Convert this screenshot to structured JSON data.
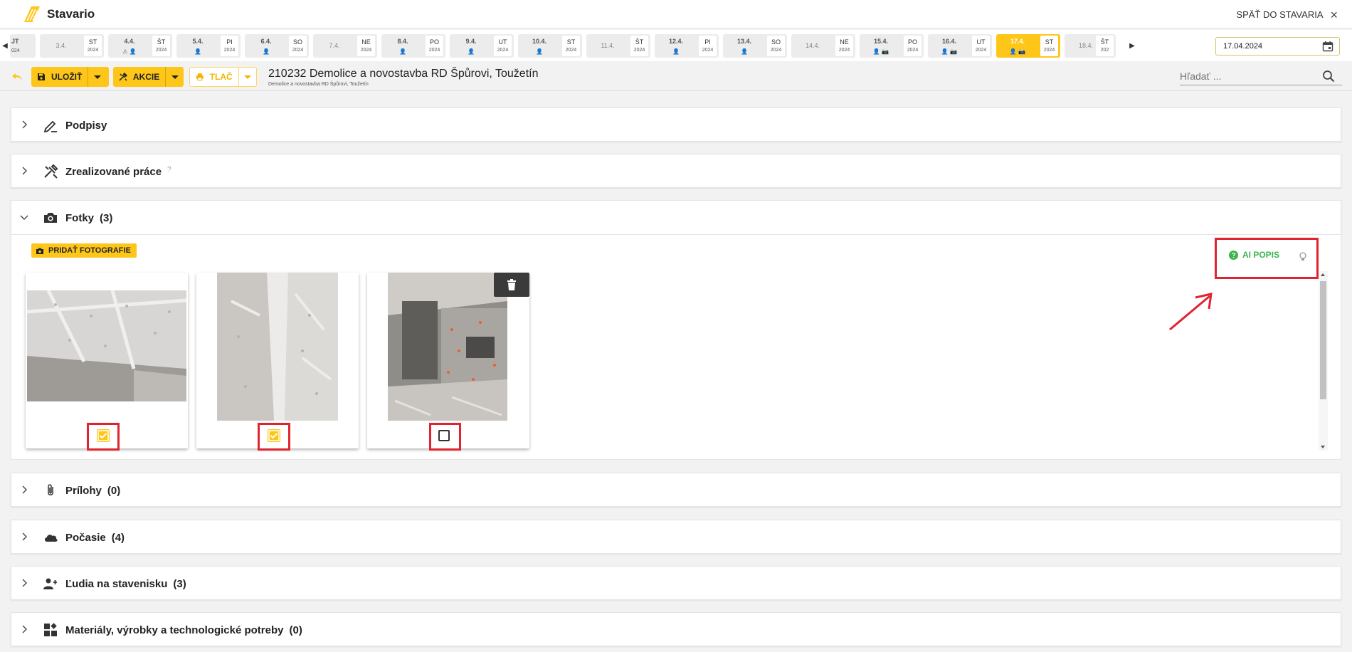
{
  "app": {
    "name": "Stavario",
    "back_label": "SPÄŤ DO STAVARIA"
  },
  "dates": {
    "items": [
      {
        "date": "JT",
        "weekday": "",
        "year": "024",
        "icons": "",
        "has_data": true,
        "active": false,
        "partial": true
      },
      {
        "date": "3.4.",
        "weekday": "ST",
        "year": "2024",
        "icons": "",
        "has_data": false,
        "active": false
      },
      {
        "date": "4.4.",
        "weekday": "ŠT",
        "year": "2024",
        "icons": "⚠ 👤",
        "has_data": true,
        "active": false
      },
      {
        "date": "5.4.",
        "weekday": "PI",
        "year": "2024",
        "icons": "👤",
        "has_data": true,
        "active": false
      },
      {
        "date": "6.4.",
        "weekday": "SO",
        "year": "2024",
        "icons": "👤",
        "has_data": true,
        "active": false
      },
      {
        "date": "7.4.",
        "weekday": "NE",
        "year": "2024",
        "icons": "",
        "has_data": false,
        "active": false
      },
      {
        "date": "8.4.",
        "weekday": "PO",
        "year": "2024",
        "icons": "👤",
        "has_data": true,
        "active": false
      },
      {
        "date": "9.4.",
        "weekday": "UT",
        "year": "2024",
        "icons": "👤",
        "has_data": true,
        "active": false
      },
      {
        "date": "10.4.",
        "weekday": "ST",
        "year": "2024",
        "icons": "👤",
        "has_data": true,
        "active": false
      },
      {
        "date": "11.4.",
        "weekday": "ŠT",
        "year": "2024",
        "icons": "",
        "has_data": false,
        "active": false
      },
      {
        "date": "12.4.",
        "weekday": "PI",
        "year": "2024",
        "icons": "👤",
        "has_data": true,
        "active": false
      },
      {
        "date": "13.4.",
        "weekday": "SO",
        "year": "2024",
        "icons": "👤",
        "has_data": true,
        "active": false
      },
      {
        "date": "14.4.",
        "weekday": "NE",
        "year": "2024",
        "icons": "",
        "has_data": false,
        "active": false
      },
      {
        "date": "15.4.",
        "weekday": "PO",
        "year": "2024",
        "icons": "👤 📷",
        "has_data": true,
        "active": false
      },
      {
        "date": "16.4.",
        "weekday": "UT",
        "year": "2024",
        "icons": "👤 📷",
        "has_data": true,
        "active": false
      },
      {
        "date": "17.4.",
        "weekday": "ST",
        "year": "2024",
        "icons": "👤 📷",
        "has_data": true,
        "active": true
      },
      {
        "date": "18.4.",
        "weekday": "ŠT",
        "year": "202",
        "icons": "",
        "has_data": false,
        "active": false,
        "partial_right": true
      }
    ],
    "selected_value": "17.04.2024"
  },
  "toolbar": {
    "save_label": "ULOŽIŤ",
    "actions_label": "AKCIE",
    "print_label": "TLAČ",
    "project_title": "210232 Demolice a novostavba RD Špůrovi, Toužetín",
    "project_subtitle": "Demolice a novostavba RD Špůrovi, Toužetín",
    "search_placeholder": "Hľadať ..."
  },
  "sections": {
    "signatures": {
      "title": "Podpisy"
    },
    "works": {
      "title": "Zrealizované práce",
      "help": "?"
    },
    "photos": {
      "title": "Fotky",
      "count": "(3)",
      "add_label": "PRIDAŤ FOTOGRAFIE",
      "ai_label": "AI POPIS",
      "items": [
        {
          "checked": true
        },
        {
          "checked": true
        },
        {
          "checked": false
        }
      ]
    },
    "attachments": {
      "title": "Prílohy",
      "count": "(0)"
    },
    "weather": {
      "title": "Počasie",
      "count": "(4)"
    },
    "people": {
      "title": "Ľudia na stavenisku",
      "count": "(3)"
    },
    "materials": {
      "title": "Materiály, výrobky a technologické potreby",
      "count": "(0)"
    }
  },
  "colors": {
    "accent": "#ffc61a",
    "highlight": "#e0242f",
    "ai_green": "#3cb44b"
  }
}
